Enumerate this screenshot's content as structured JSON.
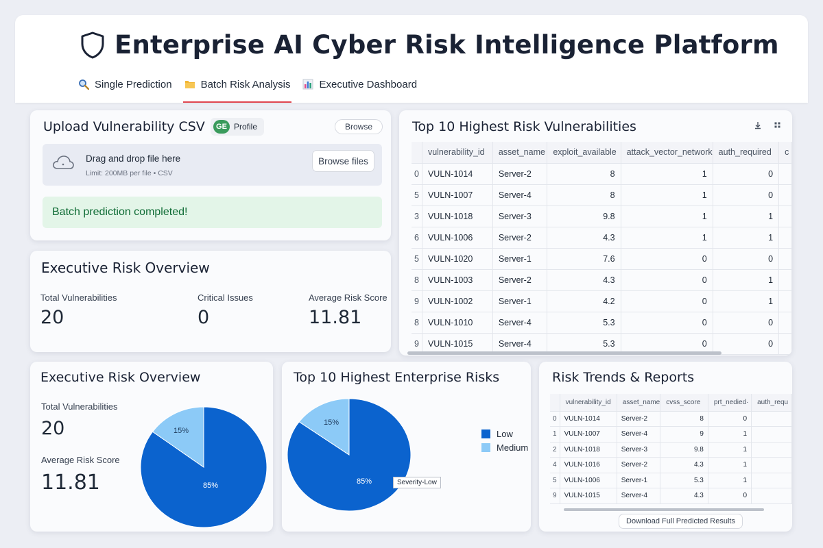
{
  "app": {
    "title": "Enterprise AI Cyber Risk Intelligence Platform",
    "tabs": [
      {
        "label": "Single Prediction",
        "icon": "magnifier-icon",
        "active": false
      },
      {
        "label": "Batch Risk Analysis",
        "icon": "folder-icon",
        "active": true
      },
      {
        "label": "Executive Dashboard",
        "icon": "bar-chart-icon",
        "active": false
      }
    ]
  },
  "upload": {
    "heading": "Upload Vulnerability CSV",
    "profile_label": "Profile",
    "profile_badge": "GE",
    "browse_label": "Browse",
    "drop_text": "Drag and drop file here",
    "limit_text": "Limit: 200MB per file • CSV",
    "browse_files_label": "Browse files",
    "success_message": "Batch prediction completed!"
  },
  "overview": {
    "heading": "Executive Risk Overview",
    "metrics": [
      {
        "label": "Total Vulnerabilities",
        "value": "20"
      },
      {
        "label": "Critical Issues",
        "value": "0"
      },
      {
        "label": "Average Risk Score",
        "value": "11.81"
      }
    ]
  },
  "top10": {
    "heading": "Top 10 Highest Risk Vulnerabilities",
    "columns": [
      "vulnerability_id",
      "asset_name",
      "exploit_available",
      "attack_vector_network",
      "auth_required",
      "c"
    ],
    "rows": [
      [
        "0",
        "VULN-1014",
        "Server-2",
        "8",
        "1",
        "0"
      ],
      [
        "5",
        "VULN-1007",
        "Server-4",
        "8",
        "1",
        "0"
      ],
      [
        "3",
        "VULN-1018",
        "Server-3",
        "9.8",
        "1",
        "1"
      ],
      [
        "6",
        "VULN-1006",
        "Server-2",
        "4.3",
        "1",
        "1"
      ],
      [
        "5",
        "VULN-1020",
        "Server-1",
        "7.6",
        "0",
        "0"
      ],
      [
        "8",
        "VULN-1003",
        "Server-2",
        "4.3",
        "0",
        "1"
      ],
      [
        "9",
        "VULN-1002",
        "Server-1",
        "4.2",
        "0",
        "1"
      ],
      [
        "8",
        "VULN-1010",
        "Server-4",
        "5.3",
        "0",
        "0"
      ],
      [
        "9",
        "VULN-1015",
        "Server-4",
        "5.3",
        "0",
        "0"
      ]
    ]
  },
  "overview2": {
    "heading": "Executive Risk Overview",
    "total_label": "Total Vulnerabilities",
    "total_value": "20",
    "avg_label": "Average Risk Score",
    "avg_value": "11.81",
    "pie": {
      "slices": [
        {
          "label": "85%",
          "value": 85,
          "color": "#0b63ce"
        },
        {
          "label": "15%",
          "value": 15,
          "color": "#8ccaf7"
        }
      ]
    }
  },
  "top_risks": {
    "heading": "Top 10 Highest Enterprise Risks",
    "legend": [
      {
        "label": "Low",
        "color": "#0b63ce"
      },
      {
        "label": "Medium",
        "color": "#8ccaf7"
      }
    ],
    "pie": {
      "slices": [
        {
          "label": "85%",
          "value": 85,
          "color": "#0b63ce"
        },
        {
          "label": "15%",
          "value": 15,
          "color": "#8ccaf7"
        }
      ]
    },
    "tooltip": "Severity-Low"
  },
  "trends": {
    "heading": "Risk Trends & Reports",
    "columns": [
      "vulnerability_id",
      "asset_name",
      "cvss_score",
      "prt_nedied·",
      "auth_requ"
    ],
    "rows": [
      [
        "0",
        "VULN-1014",
        "Server-2",
        "8",
        "0",
        ""
      ],
      [
        "1",
        "VULN-1007",
        "Server-4",
        "9",
        "1",
        ""
      ],
      [
        "2",
        "VULN-1018",
        "Server-3",
        "9.8",
        "1",
        ""
      ],
      [
        "4",
        "VULN-1016",
        "Server-2",
        "4.3",
        "1",
        ""
      ],
      [
        "5",
        "VULN-1006",
        "Server-1",
        "5.3",
        "1",
        ""
      ],
      [
        "9",
        "VULN-1015",
        "Server-4",
        "4.3",
        "0",
        ""
      ]
    ],
    "download_label": "Download Full Predicted Results"
  },
  "colors": {
    "accent": "#e0454f",
    "pie_dark": "#0b63ce",
    "pie_light": "#8ccaf7",
    "success_bg": "#e3f5e8"
  }
}
